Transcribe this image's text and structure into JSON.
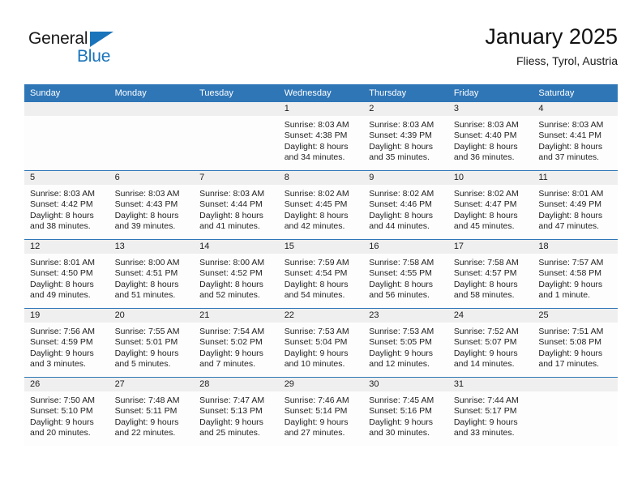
{
  "brand": {
    "name_top": "General",
    "name_bottom": "Blue",
    "triangle_icon": "triangle-icon",
    "color_black": "#1a1a1a",
    "color_blue": "#1a74bb"
  },
  "header": {
    "title": "January 2025",
    "subtitle": "Fliess, Tyrol, Austria"
  },
  "theme": {
    "header_blue": "#2f76b7",
    "band_gray": "#efefef",
    "cell_white": "#fdfdfd",
    "text_dark": "#232323"
  },
  "weekday_headers": [
    "Sunday",
    "Monday",
    "Tuesday",
    "Wednesday",
    "Thursday",
    "Friday",
    "Saturday"
  ],
  "weeks": [
    [
      {
        "day": "",
        "lines": []
      },
      {
        "day": "",
        "lines": []
      },
      {
        "day": "",
        "lines": []
      },
      {
        "day": "1",
        "lines": [
          "Sunrise: 8:03 AM",
          "Sunset: 4:38 PM",
          "Daylight: 8 hours",
          "and 34 minutes."
        ]
      },
      {
        "day": "2",
        "lines": [
          "Sunrise: 8:03 AM",
          "Sunset: 4:39 PM",
          "Daylight: 8 hours",
          "and 35 minutes."
        ]
      },
      {
        "day": "3",
        "lines": [
          "Sunrise: 8:03 AM",
          "Sunset: 4:40 PM",
          "Daylight: 8 hours",
          "and 36 minutes."
        ]
      },
      {
        "day": "4",
        "lines": [
          "Sunrise: 8:03 AM",
          "Sunset: 4:41 PM",
          "Daylight: 8 hours",
          "and 37 minutes."
        ]
      }
    ],
    [
      {
        "day": "5",
        "lines": [
          "Sunrise: 8:03 AM",
          "Sunset: 4:42 PM",
          "Daylight: 8 hours",
          "and 38 minutes."
        ]
      },
      {
        "day": "6",
        "lines": [
          "Sunrise: 8:03 AM",
          "Sunset: 4:43 PM",
          "Daylight: 8 hours",
          "and 39 minutes."
        ]
      },
      {
        "day": "7",
        "lines": [
          "Sunrise: 8:03 AM",
          "Sunset: 4:44 PM",
          "Daylight: 8 hours",
          "and 41 minutes."
        ]
      },
      {
        "day": "8",
        "lines": [
          "Sunrise: 8:02 AM",
          "Sunset: 4:45 PM",
          "Daylight: 8 hours",
          "and 42 minutes."
        ]
      },
      {
        "day": "9",
        "lines": [
          "Sunrise: 8:02 AM",
          "Sunset: 4:46 PM",
          "Daylight: 8 hours",
          "and 44 minutes."
        ]
      },
      {
        "day": "10",
        "lines": [
          "Sunrise: 8:02 AM",
          "Sunset: 4:47 PM",
          "Daylight: 8 hours",
          "and 45 minutes."
        ]
      },
      {
        "day": "11",
        "lines": [
          "Sunrise: 8:01 AM",
          "Sunset: 4:49 PM",
          "Daylight: 8 hours",
          "and 47 minutes."
        ]
      }
    ],
    [
      {
        "day": "12",
        "lines": [
          "Sunrise: 8:01 AM",
          "Sunset: 4:50 PM",
          "Daylight: 8 hours",
          "and 49 minutes."
        ]
      },
      {
        "day": "13",
        "lines": [
          "Sunrise: 8:00 AM",
          "Sunset: 4:51 PM",
          "Daylight: 8 hours",
          "and 51 minutes."
        ]
      },
      {
        "day": "14",
        "lines": [
          "Sunrise: 8:00 AM",
          "Sunset: 4:52 PM",
          "Daylight: 8 hours",
          "and 52 minutes."
        ]
      },
      {
        "day": "15",
        "lines": [
          "Sunrise: 7:59 AM",
          "Sunset: 4:54 PM",
          "Daylight: 8 hours",
          "and 54 minutes."
        ]
      },
      {
        "day": "16",
        "lines": [
          "Sunrise: 7:58 AM",
          "Sunset: 4:55 PM",
          "Daylight: 8 hours",
          "and 56 minutes."
        ]
      },
      {
        "day": "17",
        "lines": [
          "Sunrise: 7:58 AM",
          "Sunset: 4:57 PM",
          "Daylight: 8 hours",
          "and 58 minutes."
        ]
      },
      {
        "day": "18",
        "lines": [
          "Sunrise: 7:57 AM",
          "Sunset: 4:58 PM",
          "Daylight: 9 hours",
          "and 1 minute."
        ]
      }
    ],
    [
      {
        "day": "19",
        "lines": [
          "Sunrise: 7:56 AM",
          "Sunset: 4:59 PM",
          "Daylight: 9 hours",
          "and 3 minutes."
        ]
      },
      {
        "day": "20",
        "lines": [
          "Sunrise: 7:55 AM",
          "Sunset: 5:01 PM",
          "Daylight: 9 hours",
          "and 5 minutes."
        ]
      },
      {
        "day": "21",
        "lines": [
          "Sunrise: 7:54 AM",
          "Sunset: 5:02 PM",
          "Daylight: 9 hours",
          "and 7 minutes."
        ]
      },
      {
        "day": "22",
        "lines": [
          "Sunrise: 7:53 AM",
          "Sunset: 5:04 PM",
          "Daylight: 9 hours",
          "and 10 minutes."
        ]
      },
      {
        "day": "23",
        "lines": [
          "Sunrise: 7:53 AM",
          "Sunset: 5:05 PM",
          "Daylight: 9 hours",
          "and 12 minutes."
        ]
      },
      {
        "day": "24",
        "lines": [
          "Sunrise: 7:52 AM",
          "Sunset: 5:07 PM",
          "Daylight: 9 hours",
          "and 14 minutes."
        ]
      },
      {
        "day": "25",
        "lines": [
          "Sunrise: 7:51 AM",
          "Sunset: 5:08 PM",
          "Daylight: 9 hours",
          "and 17 minutes."
        ]
      }
    ],
    [
      {
        "day": "26",
        "lines": [
          "Sunrise: 7:50 AM",
          "Sunset: 5:10 PM",
          "Daylight: 9 hours",
          "and 20 minutes."
        ]
      },
      {
        "day": "27",
        "lines": [
          "Sunrise: 7:48 AM",
          "Sunset: 5:11 PM",
          "Daylight: 9 hours",
          "and 22 minutes."
        ]
      },
      {
        "day": "28",
        "lines": [
          "Sunrise: 7:47 AM",
          "Sunset: 5:13 PM",
          "Daylight: 9 hours",
          "and 25 minutes."
        ]
      },
      {
        "day": "29",
        "lines": [
          "Sunrise: 7:46 AM",
          "Sunset: 5:14 PM",
          "Daylight: 9 hours",
          "and 27 minutes."
        ]
      },
      {
        "day": "30",
        "lines": [
          "Sunrise: 7:45 AM",
          "Sunset: 5:16 PM",
          "Daylight: 9 hours",
          "and 30 minutes."
        ]
      },
      {
        "day": "31",
        "lines": [
          "Sunrise: 7:44 AM",
          "Sunset: 5:17 PM",
          "Daylight: 9 hours",
          "and 33 minutes."
        ]
      },
      {
        "day": "",
        "lines": []
      }
    ]
  ]
}
